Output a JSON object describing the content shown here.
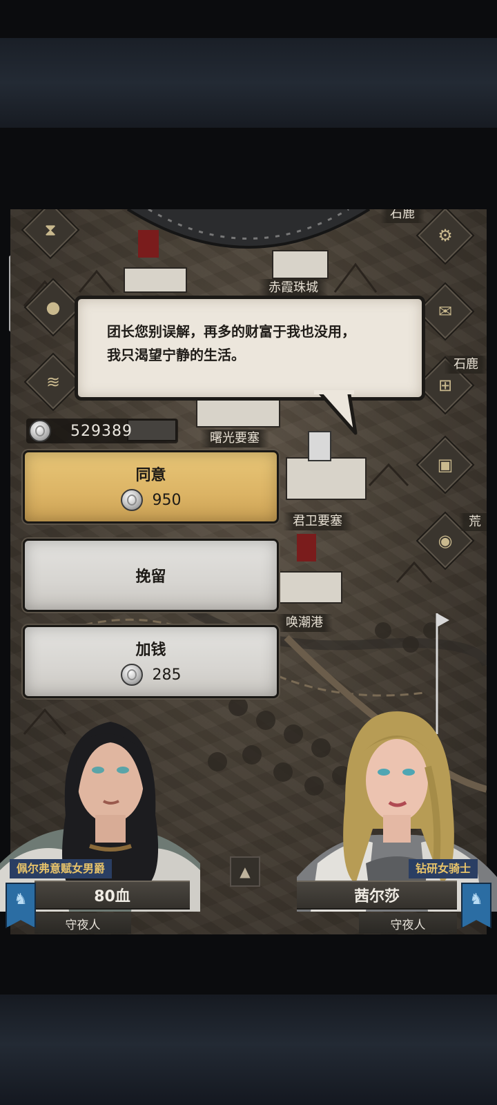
{
  "dialogue": {
    "line1": "团长您别误解，再多的财富于我也没用，",
    "line2": "我只渴望宁静的生活。"
  },
  "balance": {
    "silver": "529389",
    "icon": "silver-coin-icon"
  },
  "choices": [
    {
      "label": "同意",
      "cost": "950",
      "style": "gold"
    },
    {
      "label": "挽留",
      "cost": "",
      "style": "grey"
    },
    {
      "label": "加钱",
      "cost": "285",
      "style": "grey"
    }
  ],
  "map": {
    "towns": [
      "赤霞珠城",
      "曙光要塞",
      "君卫要塞",
      "唤潮港"
    ],
    "partial_labels": [
      "石鹿",
      "荒",
      "石鹿"
    ]
  },
  "left_character": {
    "title": "佩尔弗意赋女男爵",
    "name": "80血",
    "faction": "守夜人"
  },
  "right_character": {
    "title": "钻研女骑士",
    "name": "茜尔莎",
    "faction": "守夜人"
  },
  "side_icons": [
    "hourglass-icon",
    "money-bag-icon",
    "scroll-icon",
    "gear-icon",
    "mail-icon",
    "building-icon",
    "supplies-icon",
    "coins-icon"
  ],
  "colors": {
    "gold_button": "#dcb465",
    "grey_button": "#d7d5d1",
    "speech_bg": "#ece6dc",
    "title_tag": "#2a3e63"
  }
}
